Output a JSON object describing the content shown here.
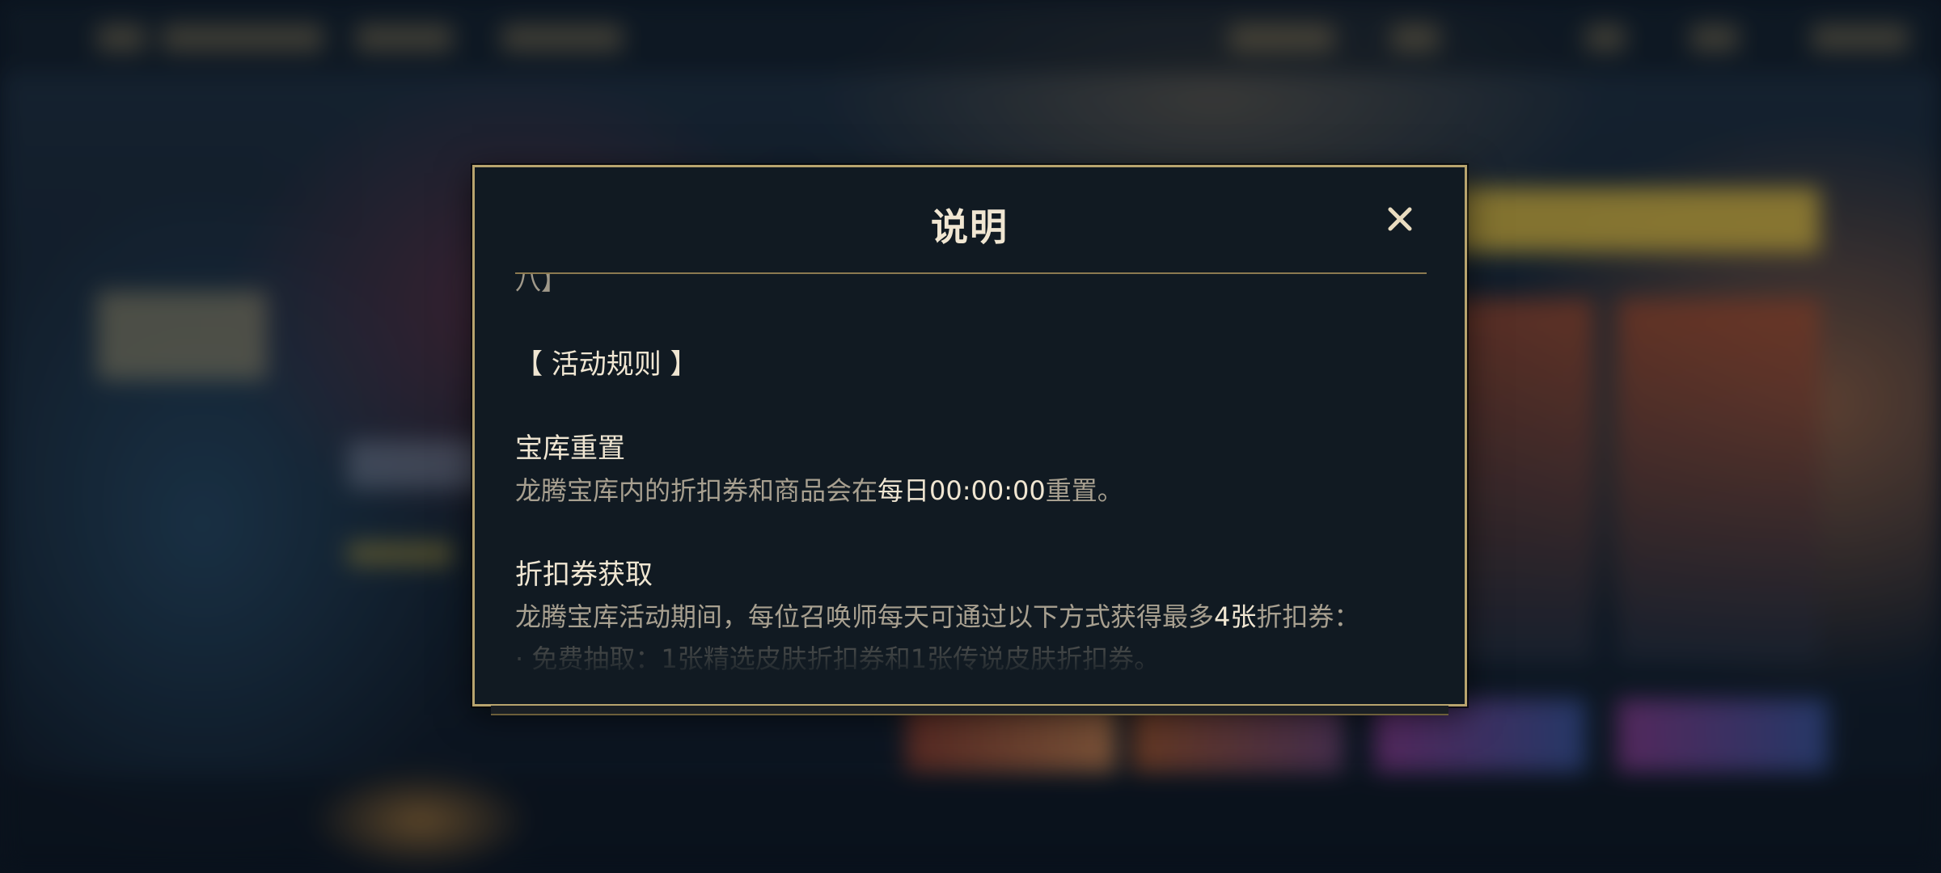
{
  "dialog": {
    "title": "说明",
    "close_icon": "close-icon",
    "accent_color": "#b8a46e",
    "clipped_top_text": "八】",
    "rules_heading": "【 活动规则 】",
    "vault_reset": {
      "title": "宝库重置",
      "text_before": "龙腾宝库内的折扣券和商品会在",
      "highlight": "每日00:00:00",
      "text_after": "重置。"
    },
    "coupon_acquire": {
      "title": "折扣券获取",
      "text_before": "龙腾宝库活动期间，每位召唤师每天可通过以下方式获得最多",
      "highlight": "4张",
      "text_after": "折扣券：",
      "bullet": "· 免费抽取：1张精选皮肤折扣券和1张传说皮肤折扣券。"
    }
  }
}
